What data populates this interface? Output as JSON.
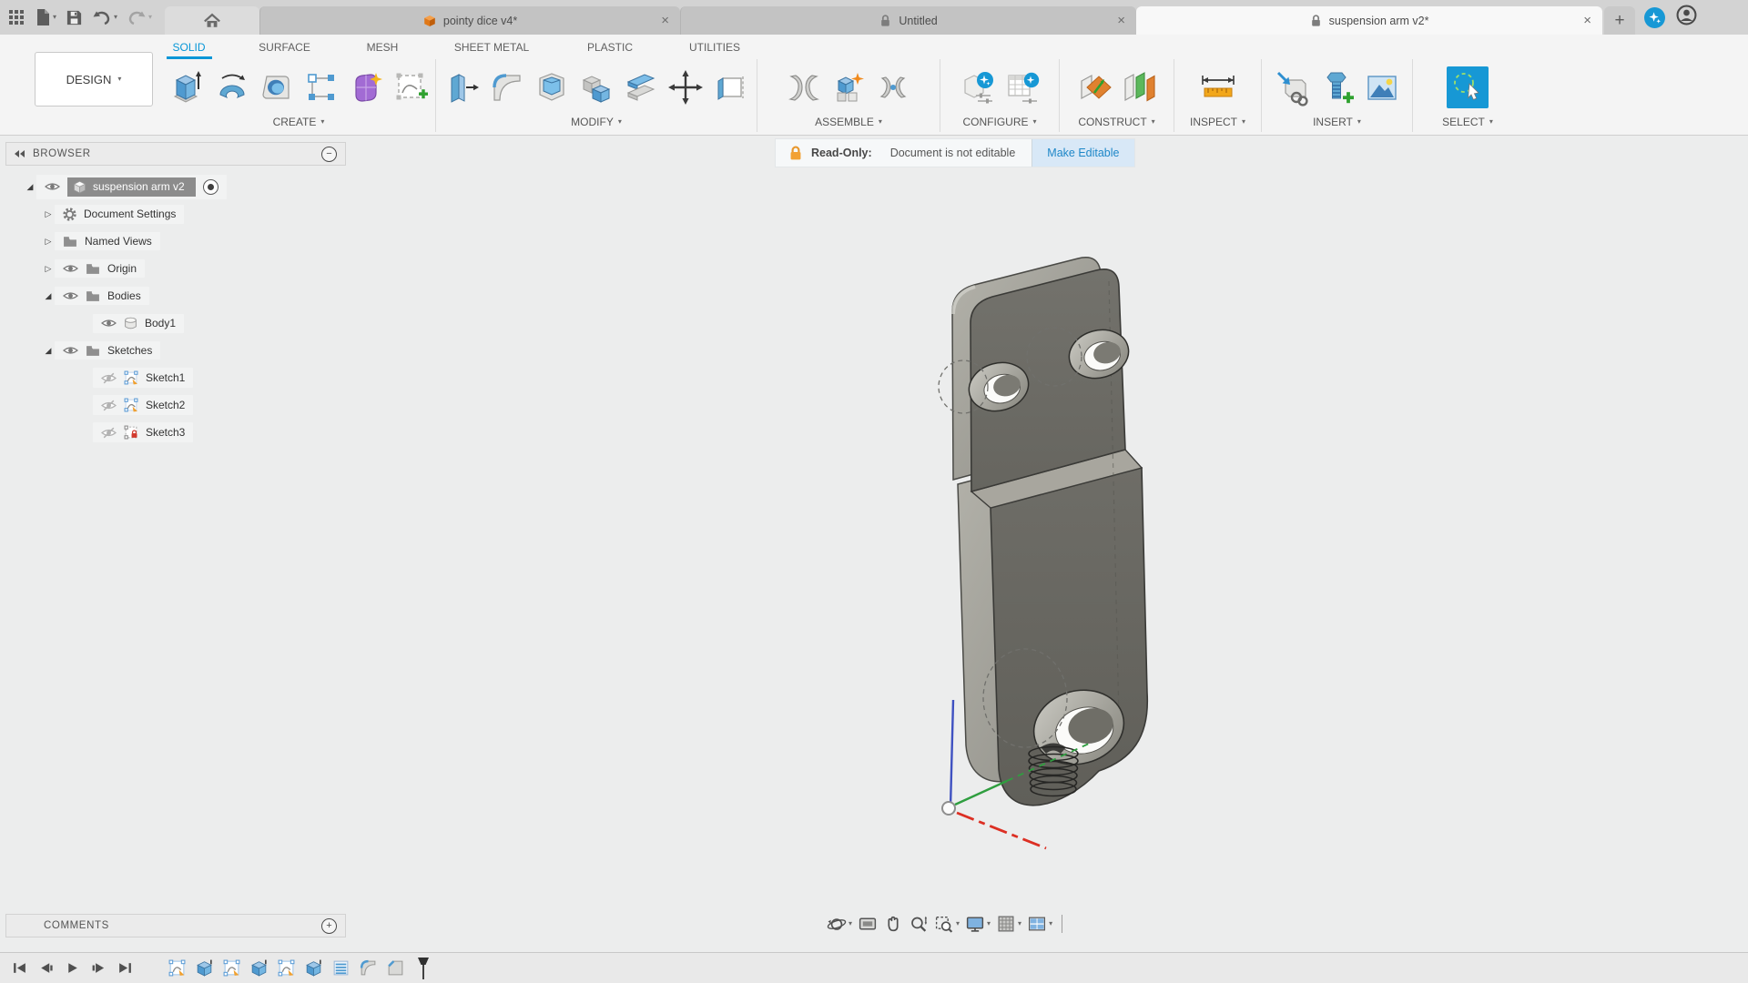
{
  "glyphs": {
    "close": "×",
    "add": "+",
    "minus": "−",
    "caret": "▾",
    "tree_expanded": "◢",
    "tree_collapsed": "▷"
  },
  "titlebar": {
    "tabs": [
      {
        "label": "pointy dice v4*",
        "icon": "cube",
        "state": "inactive"
      },
      {
        "label": "Untitled",
        "icon": "lock",
        "state": "inactive"
      },
      {
        "label": "suspension arm v2*",
        "icon": "lock",
        "state": "active"
      }
    ]
  },
  "ribbon": {
    "workspace": "DESIGN",
    "tabs": [
      "SOLID",
      "SURFACE",
      "MESH",
      "SHEET METAL",
      "PLASTIC",
      "UTILITIES"
    ],
    "active_tab": "SOLID",
    "groups": [
      {
        "label": "CREATE",
        "tools": [
          "extrude",
          "revolve",
          "hole",
          "rectangular-pattern",
          "create-form",
          "create-sketch"
        ]
      },
      {
        "label": "MODIFY",
        "tools": [
          "press-pull",
          "fillet",
          "shell",
          "combine",
          "split-body",
          "move-copy",
          "align"
        ]
      },
      {
        "label": "ASSEMBLE",
        "tools": [
          "joint",
          "new-component",
          "joint-origin"
        ]
      },
      {
        "label": "CONFIGURE",
        "tools": [
          "configuration",
          "configuration-table"
        ]
      },
      {
        "label": "CONSTRUCT",
        "tools": [
          "construction-plane",
          "offset-plane"
        ]
      },
      {
        "label": "INSPECT",
        "tools": [
          "measure"
        ]
      },
      {
        "label": "INSERT",
        "tools": [
          "insert-derive",
          "insert-fastener",
          "canvas"
        ]
      },
      {
        "label": "SELECT",
        "tools": [
          "select"
        ]
      }
    ]
  },
  "banner": {
    "title": "Read-Only:",
    "message": "Document is not editable",
    "action": "Make Editable"
  },
  "browser": {
    "title": "BROWSER",
    "items": [
      {
        "label": "suspension arm v2",
        "icon": "component",
        "expanded": true,
        "visible": true,
        "selected": true
      },
      {
        "label": "Document Settings",
        "icon": "gear",
        "expanded": false
      },
      {
        "label": "Named Views",
        "icon": "folder",
        "expanded": false
      },
      {
        "label": "Origin",
        "icon": "folder",
        "expanded": false,
        "visible": true
      },
      {
        "label": "Bodies",
        "icon": "folder",
        "expanded": true,
        "visible": true
      },
      {
        "label": "Body1",
        "icon": "body",
        "visible": true
      },
      {
        "label": "Sketches",
        "icon": "folder",
        "expanded": true,
        "visible": true
      },
      {
        "label": "Sketch1",
        "icon": "sketch",
        "visible": false
      },
      {
        "label": "Sketch2",
        "icon": "sketch",
        "visible": false
      },
      {
        "label": "Sketch3",
        "icon": "sketch-locked",
        "visible": false
      }
    ]
  },
  "comments": {
    "title": "COMMENTS"
  },
  "viewport_nav": {
    "tools": [
      "orbit",
      "look-at",
      "pan",
      "zoom",
      "window-zoom",
      "display-settings",
      "grid-display",
      "viewports"
    ]
  },
  "timeline": {
    "playback": [
      "go-to-start",
      "step-back",
      "play",
      "step-forward",
      "go-to-end"
    ],
    "features": [
      "sketch",
      "extrude",
      "sketch",
      "extrude",
      "sketch",
      "extrude",
      "threads",
      "fillet",
      "chamfer"
    ]
  },
  "colors": {
    "accent": "#0696D7",
    "readonly_lock": "#F2A11B",
    "link_blue": "#1E87C8",
    "selection_gray": "#8C8C8C",
    "axis_x_red": "#DC2F23",
    "axis_y_green": "#2F9E3F",
    "axis_z_blue": "#3F51C1",
    "model_face": "#6B6A64",
    "model_side": "#9B9A93"
  }
}
